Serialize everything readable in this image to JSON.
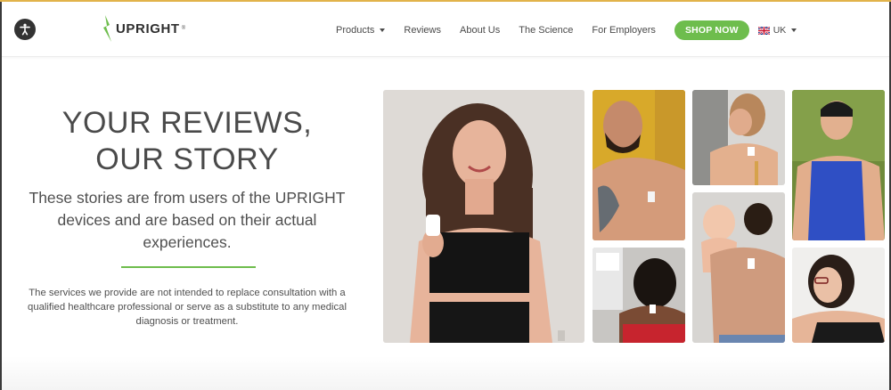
{
  "accessibility": {
    "icon": "accessibility-icon"
  },
  "logo": {
    "text": "UPRIGHT",
    "reg": "®",
    "accent": "#6ebd4d"
  },
  "nav": {
    "products": "Products",
    "reviews": "Reviews",
    "about": "About Us",
    "science": "The Science",
    "employers": "For Employers",
    "shop": "SHOP NOW",
    "lang": "UK"
  },
  "hero": {
    "title_line1": "YOUR REVIEWS,",
    "title_line2": "OUR STORY",
    "subtitle": "These stories are from users of the UPRIGHT devices and are based on their actual experiences.",
    "disclaimer": "The services we provide are not intended to replace consultation with a qualified healthcare professional or serve as a substitute to any medical diagnosis or treatment."
  },
  "photos": [
    {
      "name": "woman-holding-device-photo"
    },
    {
      "name": "bearded-man-device-photo"
    },
    {
      "name": "woman-back-device-photo"
    },
    {
      "name": "man-blue-tank-photo"
    },
    {
      "name": "woman-desk-device-photo"
    },
    {
      "name": "man-with-baby-photo"
    },
    {
      "name": "woman-glasses-device-photo"
    }
  ],
  "colors": {
    "brand_green": "#6ebd4d",
    "text": "#4a4a4a"
  }
}
